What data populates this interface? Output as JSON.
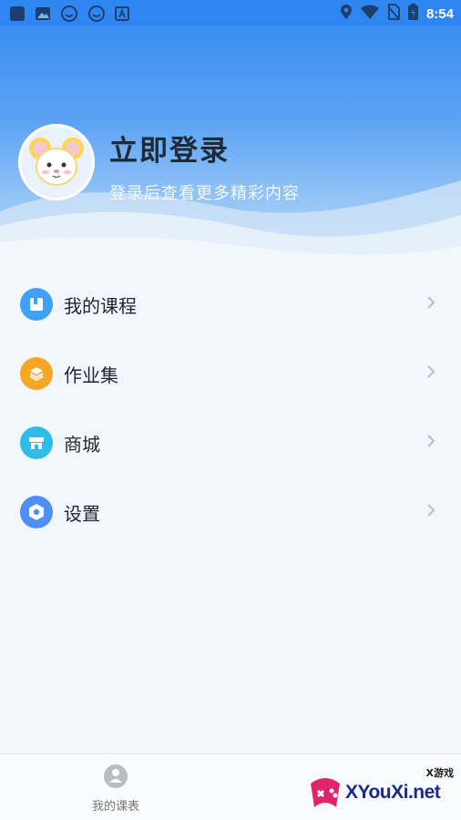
{
  "status_bar": {
    "time": "8:54"
  },
  "header": {
    "title": "立即登录",
    "subtitle": "登录后查看更多精彩内容"
  },
  "menu": {
    "items": [
      {
        "label": "我的课程",
        "icon": "book-icon",
        "color": "#3fa0f5"
      },
      {
        "label": "作业集",
        "icon": "layers-icon",
        "color": "#f6a623"
      },
      {
        "label": "商城",
        "icon": "store-icon",
        "color": "#2dbde8"
      },
      {
        "label": "设置",
        "icon": "settings-hexagon-icon",
        "color": "#4d8ff2"
      }
    ]
  },
  "bottom_nav": {
    "tabs": [
      {
        "label": "我的课表",
        "icon": "schedule-icon"
      }
    ]
  },
  "watermark": {
    "text": "XYouXi.net",
    "small": "X游戏"
  }
}
